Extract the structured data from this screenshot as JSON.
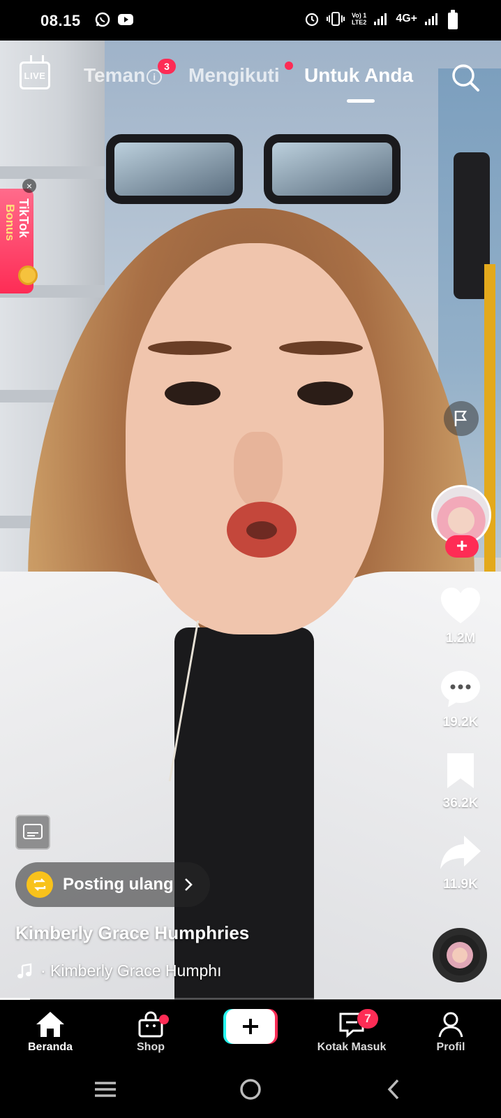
{
  "status_bar": {
    "time": "08.15",
    "left_icons": [
      "whatsapp-icon",
      "youtube-icon"
    ],
    "right_icons": [
      "alarm-icon",
      "vibrate-icon",
      "volte-icon",
      "signal-icon",
      "signal-icon",
      "battery-icon"
    ],
    "volte_label": "Vo) 1\nLTE2",
    "network_label": "4G+"
  },
  "top_nav": {
    "live_label": "LIVE",
    "tabs": [
      {
        "label": "Teman",
        "badge": "3"
      },
      {
        "label": "Mengikuti"
      },
      {
        "label": "Untuk Anda",
        "active": true
      }
    ]
  },
  "bonus": {
    "title": "TikTok",
    "subtitle": "Bonus",
    "close": "×"
  },
  "rail": {
    "follow": "+",
    "likes": "1.2M",
    "comments": "19.2K",
    "saves": "36.2K",
    "shares": "11.9K"
  },
  "video": {
    "repost_label": "Posting ulang",
    "username": "Kimberly Grace Humphries",
    "music": "· Kimberly Grace Humphı",
    "progress": 0.06
  },
  "bottom_nav": {
    "items": [
      {
        "label": "Beranda",
        "icon": "home-icon",
        "active": true
      },
      {
        "label": "Shop",
        "icon": "shop-bag-icon"
      },
      {
        "label": "",
        "icon": "create-plus-icon"
      },
      {
        "label": "Kotak Masuk",
        "icon": "inbox-icon",
        "badge": "7"
      },
      {
        "label": "Profil",
        "icon": "profile-icon"
      }
    ]
  },
  "colors": {
    "accent": "#fe2c55",
    "cyan": "#25f4ee",
    "repost": "#f8c21b"
  }
}
